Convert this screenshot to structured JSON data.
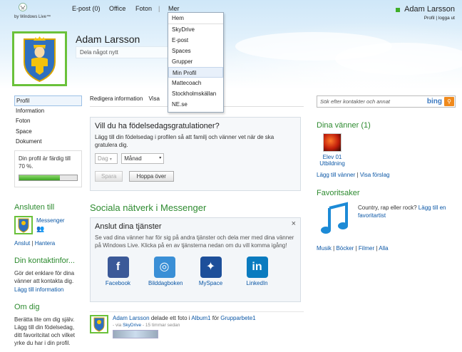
{
  "top_nav": {
    "logo_by": "by Windows Live™",
    "items": [
      {
        "label": "E-post (0)"
      },
      {
        "label": "Office"
      },
      {
        "label": "Foton"
      },
      {
        "label": "|"
      },
      {
        "label": "Mer"
      }
    ]
  },
  "user": {
    "name": "Adam Larsson",
    "profile_link": "Profil",
    "separator": "|",
    "logout_link": "logga ut"
  },
  "profile": {
    "name": "Adam Larsson",
    "status_placeholder": "Dela något nytt"
  },
  "dropdown": {
    "items": [
      {
        "label": "Hem"
      },
      {
        "label": "SkyDrive"
      },
      {
        "label": "E-post"
      },
      {
        "label": "Spaces"
      },
      {
        "label": "Grupper"
      },
      {
        "label": "Min Profil"
      },
      {
        "label": "Mattecoach"
      },
      {
        "label": "Stockholmskällan"
      },
      {
        "label": "NE.se"
      }
    ]
  },
  "left_nav": {
    "items": [
      {
        "label": "Profil"
      },
      {
        "label": "Information"
      },
      {
        "label": "Foton"
      },
      {
        "label": "Space"
      },
      {
        "label": "Dokument"
      }
    ],
    "progress_text": "Din profil är färdig till 70 %.",
    "progress_value": 0.7,
    "connected_heading": "Ansluten till",
    "messenger_label": "Messenger",
    "anslut": "Anslut",
    "hantera": "Hantera",
    "link_sep": "|",
    "contact_heading": "Din kontaktinfor...",
    "contact_text": "Gör det enklare för dina vänner att kontakta dig.",
    "contact_link": "Lägg till information",
    "about_heading": "Om dig",
    "about_text": "Berätta lite om dig själv. Lägg till din födelsedag, ditt favoritcitat och vilket yrke du har i din profil."
  },
  "center": {
    "tab_edit": "Redigera information",
    "tab_view": "Visa",
    "birthday_title": "Vill du ha födelsedagsgratulationer?",
    "birthday_text": "Lägg till din födelsedag i profilen så att familj och vänner vet när de ska gratulera dig.",
    "day_placeholder": "Dag",
    "month_placeholder": "Månad",
    "save_btn": "Spara",
    "skip_btn": "Hoppa över",
    "social_heading": "Sociala nätverk i Messenger",
    "connect_title": "Anslut dina tjänster",
    "close_glyph": "×",
    "connect_text": "Se vad dina vänner har för sig på andra tjänster och dela mer med dina vänner på Windows Live. Klicka på en av tjänsterna nedan om du vill komma igång!",
    "services": [
      {
        "label": "Facebook",
        "icon": "facebook-icon",
        "glyph": "f",
        "color": "#3b5998"
      },
      {
        "label": "Bilddagboken",
        "icon": "bilddagboken-icon",
        "glyph": "◎",
        "color": "#3a8fd6"
      },
      {
        "label": "MySpace",
        "icon": "myspace-icon",
        "glyph": "✦",
        "color": "#1d4f9a"
      },
      {
        "label": "LinkedIn",
        "icon": "linkedin-icon",
        "glyph": "in",
        "color": "#0a7bbf"
      }
    ],
    "feed": {
      "actor": "Adam Larsson",
      "text1": "delade ett foto i",
      "album": "Album1",
      "text2": "för",
      "group": "Grupparbete1",
      "via": "- via",
      "via_service": "SkyDrive",
      "time": "- 15 timmar sedan"
    }
  },
  "right": {
    "search_placeholder": "Sök efter kontakter och annat",
    "search_brand": "bing",
    "friends_heading": "Dina vänner (1)",
    "friend_name_1": "Elev 01",
    "friend_name_2": "Utbildning",
    "add_friends": "Lägg till vänner",
    "link_sep": "|",
    "show_suggestions": "Visa förslag",
    "favorites_heading": "Favoritsaker",
    "favorites_text": "Country, rap eller rock?",
    "favorites_link": "Lägg till en favoritartist",
    "categories": [
      "Musik",
      "Böcker",
      "Filmer",
      "Alla"
    ]
  },
  "colors": {
    "link": "#0b57a6",
    "heading_green": "#2e8b30",
    "avatar_border": "#6ac13a"
  }
}
